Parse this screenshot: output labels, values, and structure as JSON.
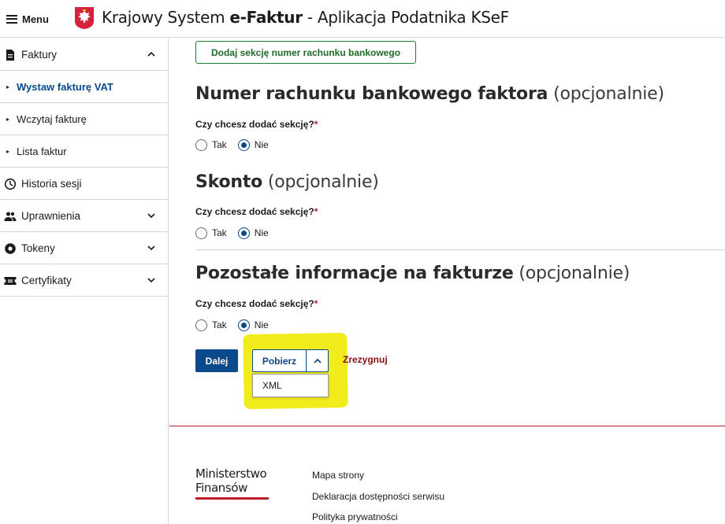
{
  "header": {
    "menu_label": "Menu",
    "title_prefix": "Krajowy System ",
    "title_brand": "e-Faktur",
    "title_suffix": " - Aplikacja Podatnika KSeF"
  },
  "sidebar": {
    "items": [
      {
        "label": "Faktury",
        "icon": "document-icon",
        "expanded": true
      },
      {
        "label": "Wystaw fakturę VAT",
        "active": true
      },
      {
        "label": "Wczytaj fakturę"
      },
      {
        "label": "Lista faktur"
      },
      {
        "label": "Historia sesji",
        "icon": "clock-icon"
      },
      {
        "label": "Uprawnienia",
        "icon": "users-icon"
      },
      {
        "label": "Tokeny",
        "icon": "token-icon"
      },
      {
        "label": "Certyfikaty",
        "icon": "certificate-icon"
      }
    ]
  },
  "main": {
    "add_bank_section_label": "Dodaj sekcję numer rachunku bankowego",
    "sections": [
      {
        "title": "Numer rachunku bankowego faktora",
        "optional": "(opcjonalnie)",
        "question": "Czy chcesz dodać sekcję?",
        "required_mark": "*",
        "yes_label": "Tak",
        "no_label": "Nie",
        "selected": "Nie"
      },
      {
        "title": "Skonto",
        "optional": "(opcjonalnie)",
        "question": "Czy chcesz dodać sekcję?",
        "required_mark": "*",
        "yes_label": "Tak",
        "no_label": "Nie",
        "selected": "Nie"
      },
      {
        "title": "Pozostałe informacje na fakturze",
        "optional": "(opcjonalnie)",
        "question": "Czy chcesz dodać sekcję?",
        "required_mark": "*",
        "yes_label": "Tak",
        "no_label": "Nie",
        "selected": "Nie"
      }
    ],
    "actions": {
      "next_label": "Dalej",
      "download_label": "Pobierz",
      "download_options": [
        "XML"
      ],
      "cancel_label": "Zrezygnuj"
    }
  },
  "footer": {
    "ministry_line1": "Ministerstwo",
    "ministry_line2": "Finansów",
    "links": [
      "Mapa strony",
      "Deklaracja dostępności serwisu",
      "Polityka prywatności"
    ]
  },
  "colors": {
    "primary": "#0a4a8c",
    "success": "#1e7a2e",
    "danger": "#c01c28",
    "highlight": "#f3ec1c"
  }
}
